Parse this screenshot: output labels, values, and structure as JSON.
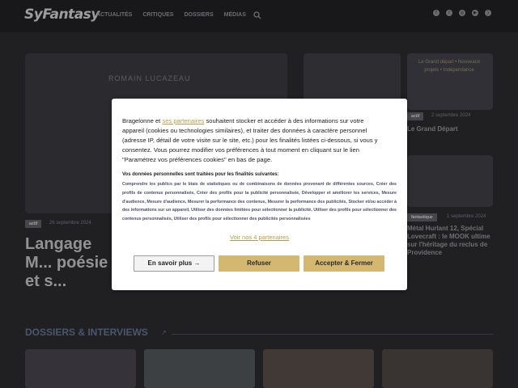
{
  "header": {
    "logo": "SyFantasy",
    "nav": [
      "Actualités",
      "Critiques",
      "Dossiers",
      "Médias"
    ],
    "socials": [
      "facebook-icon",
      "twitter-icon",
      "instagram-icon",
      "youtube-icon",
      "rss-icon"
    ]
  },
  "featured": {
    "big": {
      "image_text": "ROMAIN LUCAZEAU",
      "tag": "actif",
      "date": "26 septembre 2024",
      "title": "Langage M... poésie et s... s'entremêl..."
    },
    "right_top": {
      "image_text": "Le Grand départ • Nouveaux projets • Indépendance",
      "tag": "actif",
      "date": "2 septembre 2024",
      "title": "Le Grand Départ"
    },
    "right_bottom": {
      "tag": "fantastique",
      "date": "1 septembre 2024",
      "title": "Métal Hurlant 12, Spécial Lovecraft : le MOOK ultime sur l'héritage du reclus de Providence"
    }
  },
  "section": {
    "title": "DOSSIERS & INTERVIEWS"
  },
  "consent": {
    "intro_pre": "Bragelonne et ",
    "intro_link": "ses partenaires",
    "intro_post": " souhaitent stocker et accéder à des informations sur votre appareil (cookies ou technologies similaires), et traiter des données à caractère personnel (adresse IP, détail de votre visite sur le site, etc.) pour les finalités listées ci-dessous, si vous y consentez. Vous pourrez modifier vos préférences à tout moment en cliquant sur le lien \"Paramétrez vos préférences cookies\" en bas de page.",
    "purposes_head": "Vos données personnelles sont traitées pour les finalités suivantes:",
    "purposes": "Comprendre les publics par le biais de statistiques ou de combinaisons de données provenant de différentes sources, Créer des profils de contenus personnalisés, Créer des profils pour la publicité personnalisée, Développer et améliorer les services, Mesure d'audience, Mesure d'audience, Mesurer la performance des contenus, Mesurer la performance des publicités, Stocker et/ou accéder à des informations sur un appareil, Utiliser des données limitées pour sélectionner la publicité, Utiliser des profils pour sélectionner des contenus personnalisés, Utiliser des profils pour sélectionner des publicités personnalisées",
    "partners_link": "Voir nos 4 partenaires",
    "btn_more": "En savoir plus →",
    "btn_refuse": "Refuser",
    "btn_accept": "Accepter & Fermer"
  }
}
